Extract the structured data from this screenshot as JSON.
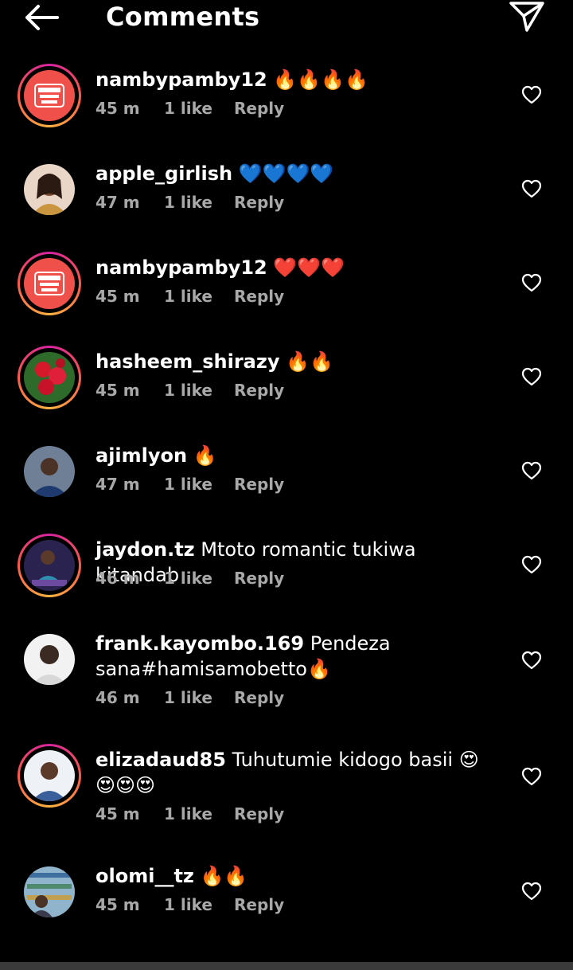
{
  "header": {
    "title": "Comments",
    "back_icon": "arrow-left-icon",
    "send_icon": "paper-plane-icon"
  },
  "comments": [
    {
      "username": "namby​pamby12",
      "text": " 🔥🔥🔥🔥",
      "time": "45 m",
      "likes": "1 like",
      "reply": "Reply",
      "ring": true,
      "avatar": "profile-badge"
    },
    {
      "username": "apple_girlish",
      "text": " 💙💙💙💙",
      "time": "47 m",
      "likes": "1 like",
      "reply": "Reply",
      "ring": false,
      "avatar": "woman-portrait"
    },
    {
      "username": "namby​pamby12",
      "text": " ❤️❤️❤️",
      "time": "45 m",
      "likes": "1 like",
      "reply": "Reply",
      "ring": true,
      "avatar": "profile-badge"
    },
    {
      "username": "hasheem_shirazy",
      "text": " 🔥🔥",
      "time": "45 m",
      "likes": "1 like",
      "reply": "Reply",
      "ring": true,
      "avatar": "roses"
    },
    {
      "username": "ajimlyon",
      "text": " 🔥",
      "time": "47 m",
      "likes": "1 like",
      "reply": "Reply",
      "ring": false,
      "avatar": "man-portrait"
    },
    {
      "username": "jaydon.tz",
      "text": " Mtoto romantic tukiwa kitandab",
      "time": "46 m",
      "likes": "1 like",
      "reply": "Reply",
      "ring": true,
      "avatar": "man-seated"
    },
    {
      "username": "frank.kayombo.169",
      "text": " Pendeza sana#hamisamobetto🔥",
      "time": "46 m",
      "likes": "1 like",
      "reply": "Reply",
      "ring": false,
      "avatar": "man-portrait-light"
    },
    {
      "username": "elizadaud85",
      "text": " Tuhutumie kidogo basii 😍😍😍😍",
      "time": "45 m",
      "likes": "1 like",
      "reply": "Reply",
      "ring": true,
      "avatar": "woman-blue"
    },
    {
      "username": "olomi__tz",
      "text": " 🔥🔥",
      "time": "45 m",
      "likes": "1 like",
      "reply": "Reply",
      "ring": false,
      "avatar": "shop-shelves"
    }
  ],
  "icons": {
    "like": "heart-outline-icon"
  }
}
